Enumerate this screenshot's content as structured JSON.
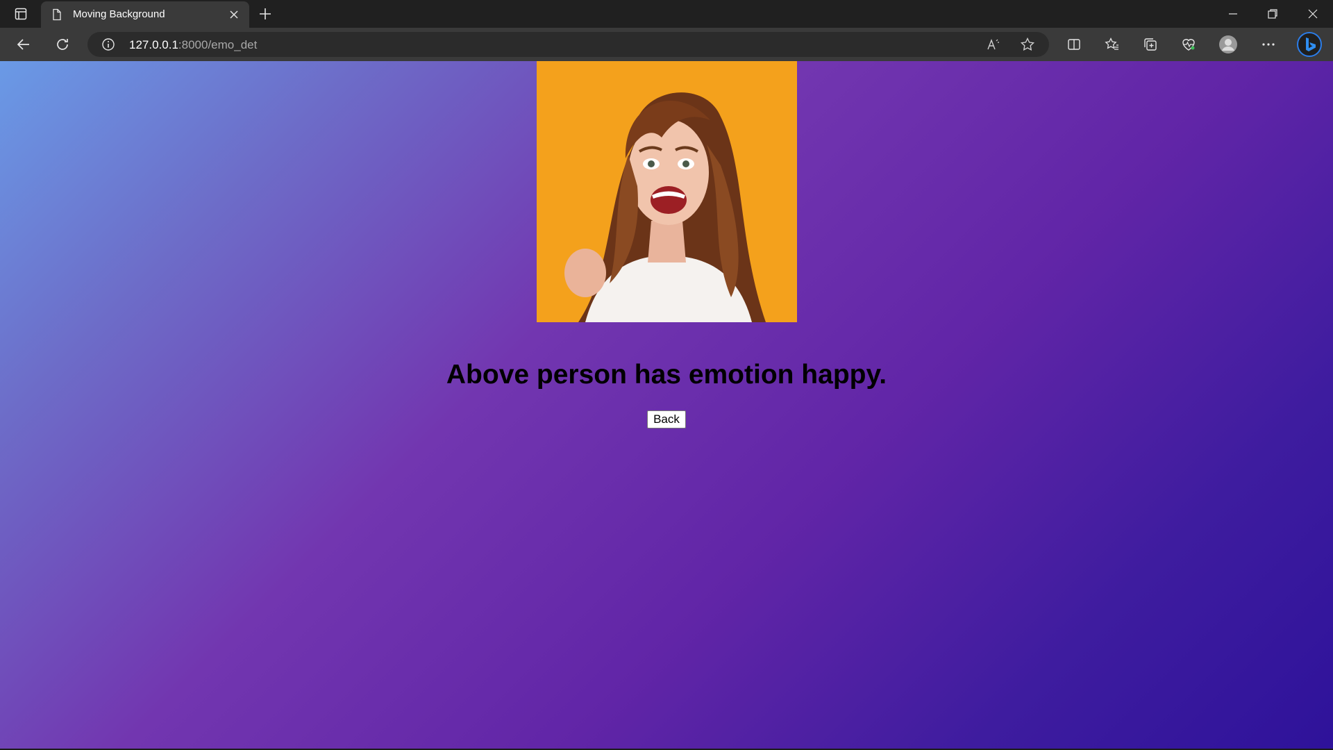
{
  "browser": {
    "tab": {
      "title": "Moving Background"
    },
    "address": {
      "host": "127.0.0.1",
      "path": ":8000/emo_det"
    },
    "colors": {
      "tabstrip": "#202020",
      "toolbar": "#3a3a3a",
      "address_bg": "#2b2b2b"
    },
    "icons": [
      "tab-actions-icon",
      "page-icon",
      "close-icon",
      "plus-icon",
      "minimize-icon",
      "restore-icon",
      "window-close-icon",
      "back-icon",
      "refresh-icon",
      "info-icon",
      "read-aloud-icon",
      "favorite-star-icon",
      "split-screen-icon",
      "favorites-icon",
      "collections-icon",
      "browser-essentials-icon",
      "profile-icon",
      "more-icon",
      "bing-icon"
    ]
  },
  "page": {
    "photo_alt": "happy woman",
    "result_text": "Above person has emotion happy.",
    "back_label": "Back",
    "colors": {
      "photo_bg": "#f5a521",
      "gradient_start": "#6a9ae6",
      "gradient_mid": "#7236b0",
      "gradient_end": "#2e129a"
    }
  }
}
